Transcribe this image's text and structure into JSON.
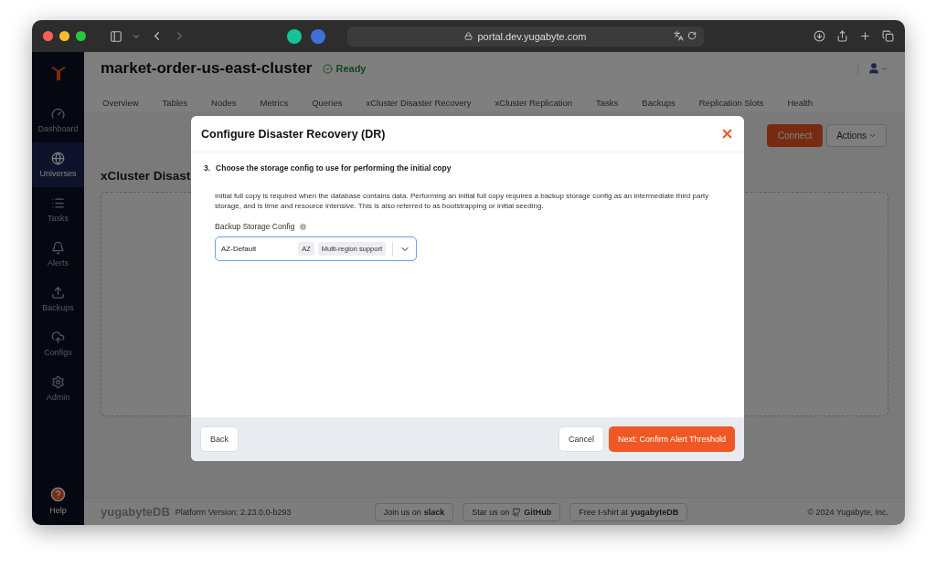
{
  "browser": {
    "url": "portal.dev.yugabyte.com"
  },
  "sidebar": {
    "items": [
      {
        "label": "Dashboard",
        "selected": false
      },
      {
        "label": "Universes",
        "selected": true
      },
      {
        "label": "Tasks",
        "selected": false
      },
      {
        "label": "Alerts",
        "selected": false
      },
      {
        "label": "Backups",
        "selected": false
      },
      {
        "label": "Configs",
        "selected": false
      },
      {
        "label": "Admin",
        "selected": false
      }
    ],
    "help": "Help"
  },
  "header": {
    "title": "market-order-us-east-cluster",
    "status": "Ready"
  },
  "tabs": [
    {
      "label": "Overview"
    },
    {
      "label": "Tables"
    },
    {
      "label": "Nodes"
    },
    {
      "label": "Metrics"
    },
    {
      "label": "Queries"
    },
    {
      "label": "xCluster Disaster Recovery"
    },
    {
      "label": "xCluster Replication"
    },
    {
      "label": "Tasks"
    },
    {
      "label": "Backups"
    },
    {
      "label": "Replication Slots"
    },
    {
      "label": "Health"
    }
  ],
  "toolbar": {
    "connect": "Connect",
    "actions": "Actions"
  },
  "section_title": "xCluster Disast",
  "modal": {
    "title": "Configure Disaster Recovery (DR)",
    "step_number": "3.",
    "step_title": "Choose the storage config to use for performing the initial copy",
    "description": "Initial full copy is required when the database contains data. Performing an initial full copy requires a backup storage config as an intermediate third party storage, and is time and resource intensive. This is also referred to as bootstrapping or initial seeding.",
    "field_label": "Backup Storage Config",
    "select": {
      "value": "AZ-Default",
      "tags": [
        "AZ",
        "Multi-region support"
      ]
    },
    "back": "Back",
    "cancel": "Cancel",
    "next": "Next: Confirm Alert Threshold"
  },
  "footer": {
    "brand": "yugabyteDB",
    "version": "Platform Version: 2.23.0.0-b293",
    "links": [
      {
        "text": "Join us on",
        "brand": "slack"
      },
      {
        "text": "Star us on",
        "brand": "GitHub"
      },
      {
        "text": "Free t-shirt at",
        "brand": "yugabyteDB"
      }
    ],
    "copyright": "© 2024 Yugabyte, Inc."
  }
}
